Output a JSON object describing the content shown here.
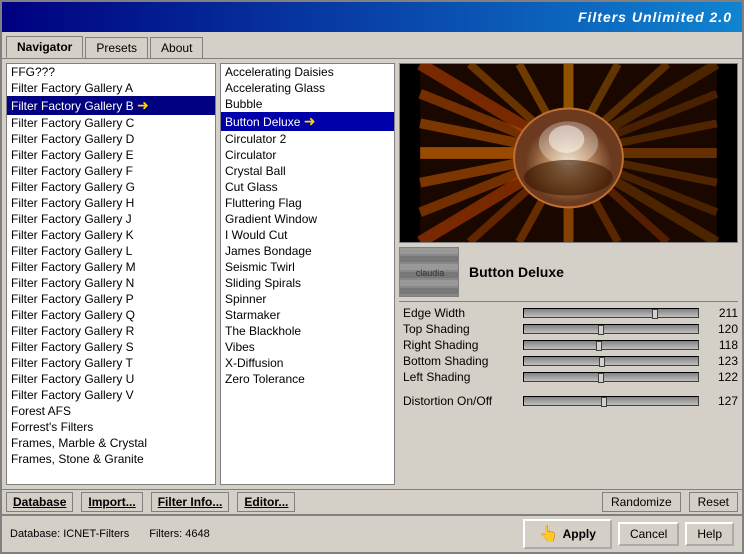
{
  "titleBar": {
    "text": "Filters Unlimited 2.0"
  },
  "tabs": [
    {
      "label": "Navigator",
      "active": true
    },
    {
      "label": "Presets",
      "active": false
    },
    {
      "label": "About",
      "active": false
    }
  ],
  "leftList": {
    "items": [
      {
        "label": "FFG???",
        "selected": false
      },
      {
        "label": "Filter Factory Gallery A",
        "selected": false
      },
      {
        "label": "Filter Factory Gallery B",
        "selected": true
      },
      {
        "label": "Filter Factory Gallery C",
        "selected": false
      },
      {
        "label": "Filter Factory Gallery D",
        "selected": false
      },
      {
        "label": "Filter Factory Gallery E",
        "selected": false
      },
      {
        "label": "Filter Factory Gallery F",
        "selected": false
      },
      {
        "label": "Filter Factory Gallery G",
        "selected": false
      },
      {
        "label": "Filter Factory Gallery H",
        "selected": false
      },
      {
        "label": "Filter Factory Gallery J",
        "selected": false
      },
      {
        "label": "Filter Factory Gallery K",
        "selected": false
      },
      {
        "label": "Filter Factory Gallery L",
        "selected": false
      },
      {
        "label": "Filter Factory Gallery M",
        "selected": false
      },
      {
        "label": "Filter Factory Gallery N",
        "selected": false
      },
      {
        "label": "Filter Factory Gallery P",
        "selected": false
      },
      {
        "label": "Filter Factory Gallery Q",
        "selected": false
      },
      {
        "label": "Filter Factory Gallery R",
        "selected": false
      },
      {
        "label": "Filter Factory Gallery S",
        "selected": false
      },
      {
        "label": "Filter Factory Gallery T",
        "selected": false
      },
      {
        "label": "Filter Factory Gallery U",
        "selected": false
      },
      {
        "label": "Filter Factory Gallery V",
        "selected": false
      },
      {
        "label": "Forest AFS",
        "selected": false
      },
      {
        "label": "Forrest's Filters",
        "selected": false
      },
      {
        "label": "Frames, Marble & Crystal",
        "selected": false
      },
      {
        "label": "Frames, Stone & Granite",
        "selected": false
      }
    ]
  },
  "filterList": {
    "items": [
      {
        "label": "Accelerating Daisies",
        "selected": false
      },
      {
        "label": "Accelerating Glass",
        "selected": false
      },
      {
        "label": "Bubble",
        "selected": false
      },
      {
        "label": "Button Deluxe",
        "selected": true
      },
      {
        "label": "Circulator 2",
        "selected": false
      },
      {
        "label": "Circulator",
        "selected": false
      },
      {
        "label": "Crystal Ball",
        "selected": false
      },
      {
        "label": "Cut Glass",
        "selected": false
      },
      {
        "label": "Fluttering Flag",
        "selected": false
      },
      {
        "label": "Gradient Window",
        "selected": false
      },
      {
        "label": "I Would Cut",
        "selected": false
      },
      {
        "label": "James Bondage",
        "selected": false
      },
      {
        "label": "Seismic Twirl",
        "selected": false
      },
      {
        "label": "Sliding Spirals",
        "selected": false
      },
      {
        "label": "Spinner",
        "selected": false
      },
      {
        "label": "Starmaker",
        "selected": false
      },
      {
        "label": "The Blackhole",
        "selected": false
      },
      {
        "label": "Vibes",
        "selected": false
      },
      {
        "label": "X-Diffusion",
        "selected": false
      },
      {
        "label": "Zero Tolerance",
        "selected": false
      }
    ]
  },
  "preview": {
    "filterName": "Button Deluxe",
    "thumbnailLabel": "claudia"
  },
  "params": [
    {
      "label": "Edge Width",
      "value": 211,
      "max": 255,
      "pct": 82
    },
    {
      "label": "Top Shading",
      "value": 120,
      "max": 255,
      "pct": 47
    },
    {
      "label": "Right Shading",
      "value": 118,
      "max": 255,
      "pct": 46
    },
    {
      "label": "Bottom Shading",
      "value": 123,
      "max": 255,
      "pct": 48
    },
    {
      "label": "Left Shading",
      "value": 122,
      "max": 255,
      "pct": 47
    },
    {
      "label": "Distortion On/Off",
      "value": 127,
      "max": 255,
      "pct": 49
    }
  ],
  "toolbar": {
    "database": "Database",
    "import": "Import...",
    "filterInfo": "Filter Info...",
    "editor": "Editor...",
    "randomize": "Randomize",
    "reset": "Reset"
  },
  "statusBar": {
    "databaseLabel": "Database:",
    "databaseValue": "ICNET-Filters",
    "filtersLabel": "Filters:",
    "filtersValue": "4648"
  },
  "buttons": {
    "apply": "Apply",
    "cancel": "Cancel",
    "help": "Help"
  }
}
